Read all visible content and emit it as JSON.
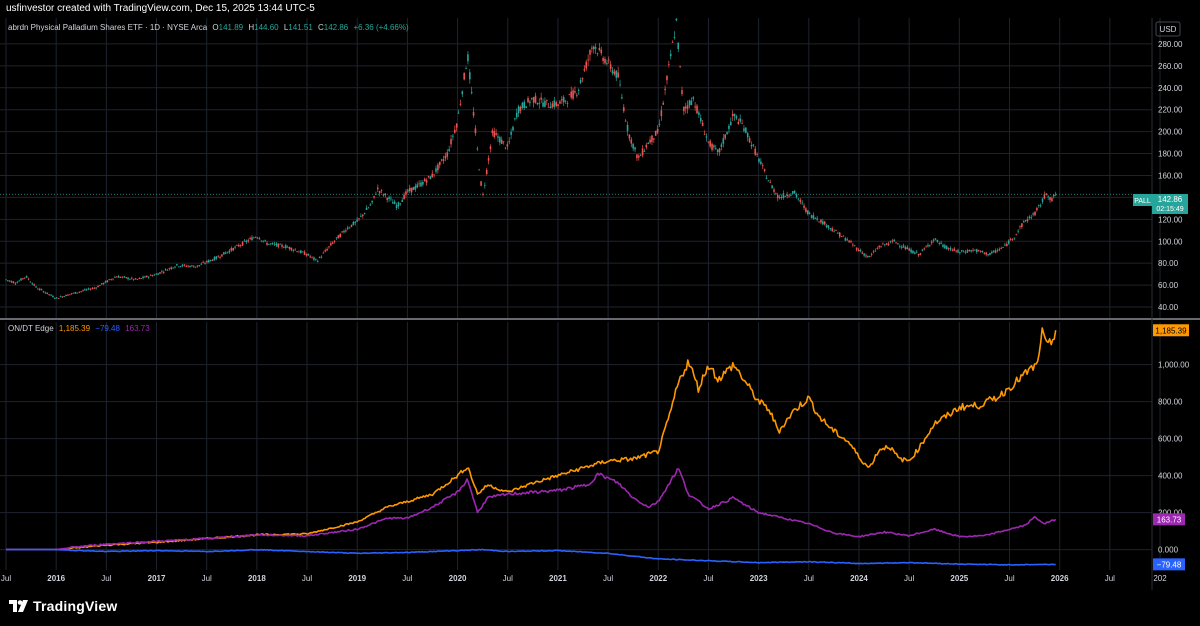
{
  "header": {
    "attribution": "usfinvestor created with TradingView.com, Dec 15, 2025 13:44 UTC-5"
  },
  "footer": {
    "brand": "TradingView"
  },
  "colors": {
    "background": "#000000",
    "grid": "#1f232e",
    "up": "#26a69a",
    "down": "#ef5350",
    "orange": "#ff9800",
    "purple": "#9c27b0",
    "blue": "#2962ff",
    "axis_text": "#d1d4dc",
    "pall_badge": "#26a69a"
  },
  "top_pane": {
    "legend": {
      "title": "abrdn Physical Palladium Shares ETF · 1D · NYSE Arca",
      "o_label": "O",
      "o": "141.89",
      "h_label": "H",
      "h": "144.60",
      "l_label": "L",
      "l": "141.51",
      "c_label": "C",
      "c": "142.86",
      "change": "+6.36 (+4.66%)"
    },
    "currency": "USD",
    "price_badge": {
      "symbol": "PALL",
      "price": "142.86",
      "countdown": "02:15:49"
    }
  },
  "bottom_pane": {
    "legend": {
      "title": "ON/DT Edge",
      "v1": "1,185.39",
      "v2": "−79.48",
      "v3": "163.73"
    },
    "badges": {
      "orange": "1,185.39",
      "purple": "163.73",
      "blue": "−79.48"
    }
  },
  "chart_data": [
    {
      "type": "candlestick",
      "title": "abrdn Physical Palladium Shares ETF · 1D · NYSE Arca",
      "ylabel": "USD",
      "ylim": [
        30,
        300
      ],
      "yticks": [
        40,
        60,
        80,
        100,
        120,
        140,
        160,
        180,
        200,
        220,
        240,
        260,
        280
      ],
      "ytick_labels": [
        "40.00",
        "60.00",
        "80.00",
        "100.00",
        "120.00",
        "140.00",
        "160.00",
        "180.00",
        "200.00",
        "220.00",
        "240.00",
        "260.00",
        "280.00"
      ],
      "grid": true,
      "x_start": 2015.5,
      "x_end": 2026.9,
      "price_path": [
        [
          2015.5,
          65
        ],
        [
          2015.6,
          62
        ],
        [
          2015.7,
          68
        ],
        [
          2015.8,
          58
        ],
        [
          2016.0,
          48
        ],
        [
          2016.15,
          52
        ],
        [
          2016.4,
          58
        ],
        [
          2016.6,
          68
        ],
        [
          2016.8,
          65
        ],
        [
          2017.0,
          70
        ],
        [
          2017.2,
          78
        ],
        [
          2017.4,
          77
        ],
        [
          2017.6,
          85
        ],
        [
          2017.8,
          95
        ],
        [
          2018.0,
          105
        ],
        [
          2018.1,
          98
        ],
        [
          2018.3,
          95
        ],
        [
          2018.5,
          88
        ],
        [
          2018.6,
          82
        ],
        [
          2018.75,
          98
        ],
        [
          2018.9,
          112
        ],
        [
          2019.0,
          118
        ],
        [
          2019.15,
          135
        ],
        [
          2019.2,
          148
        ],
        [
          2019.3,
          140
        ],
        [
          2019.4,
          132
        ],
        [
          2019.5,
          145
        ],
        [
          2019.6,
          150
        ],
        [
          2019.75,
          160
        ],
        [
          2019.9,
          180
        ],
        [
          2020.0,
          210
        ],
        [
          2020.1,
          270
        ],
        [
          2020.2,
          180
        ],
        [
          2020.25,
          140
        ],
        [
          2020.35,
          200
        ],
        [
          2020.5,
          185
        ],
        [
          2020.6,
          220
        ],
        [
          2020.75,
          230
        ],
        [
          2020.9,
          225
        ],
        [
          2021.0,
          225
        ],
        [
          2021.1,
          230
        ],
        [
          2021.2,
          238
        ],
        [
          2021.35,
          280
        ],
        [
          2021.45,
          268
        ],
        [
          2021.6,
          250
        ],
        [
          2021.7,
          200
        ],
        [
          2021.8,
          175
        ],
        [
          2021.9,
          190
        ],
        [
          2022.0,
          200
        ],
        [
          2022.1,
          255
        ],
        [
          2022.18,
          300
        ],
        [
          2022.25,
          220
        ],
        [
          2022.35,
          230
        ],
        [
          2022.5,
          190
        ],
        [
          2022.6,
          180
        ],
        [
          2022.75,
          215
        ],
        [
          2022.85,
          205
        ],
        [
          2023.0,
          175
        ],
        [
          2023.1,
          155
        ],
        [
          2023.2,
          140
        ],
        [
          2023.35,
          145
        ],
        [
          2023.5,
          125
        ],
        [
          2023.6,
          120
        ],
        [
          2023.75,
          110
        ],
        [
          2023.9,
          100
        ],
        [
          2024.0,
          92
        ],
        [
          2024.1,
          85
        ],
        [
          2024.2,
          95
        ],
        [
          2024.35,
          100
        ],
        [
          2024.5,
          92
        ],
        [
          2024.6,
          88
        ],
        [
          2024.75,
          102
        ],
        [
          2024.85,
          95
        ],
        [
          2025.0,
          90
        ],
        [
          2025.15,
          92
        ],
        [
          2025.3,
          88
        ],
        [
          2025.45,
          95
        ],
        [
          2025.55,
          105
        ],
        [
          2025.65,
          118
        ],
        [
          2025.75,
          125
        ],
        [
          2025.82,
          135
        ],
        [
          2025.87,
          145
        ],
        [
          2025.92,
          137
        ],
        [
          2025.96,
          142.86
        ]
      ],
      "last_price": 142.86,
      "series": [
        {
          "name": "PALL"
        }
      ]
    },
    {
      "type": "line",
      "title": "ON/DT Edge",
      "ylim": [
        -110,
        1230
      ],
      "yticks": [
        0,
        200,
        400,
        600,
        800,
        1000
      ],
      "ytick_labels": [
        "0.000",
        "200.00",
        "400.00",
        "600.00",
        "800.00",
        "1,000.00"
      ],
      "grid": true,
      "x_axis_ticks": [
        {
          "x": 2015.5,
          "label": "Jul"
        },
        {
          "x": 2016.0,
          "label": "2016"
        },
        {
          "x": 2016.5,
          "label": "Jul"
        },
        {
          "x": 2017.0,
          "label": "2017"
        },
        {
          "x": 2017.5,
          "label": "Jul"
        },
        {
          "x": 2018.0,
          "label": "2018"
        },
        {
          "x": 2018.5,
          "label": "Jul"
        },
        {
          "x": 2019.0,
          "label": "2019"
        },
        {
          "x": 2019.5,
          "label": "Jul"
        },
        {
          "x": 2020.0,
          "label": "2020"
        },
        {
          "x": 2020.5,
          "label": "Jul"
        },
        {
          "x": 2021.0,
          "label": "2021"
        },
        {
          "x": 2021.5,
          "label": "Jul"
        },
        {
          "x": 2022.0,
          "label": "2022"
        },
        {
          "x": 2022.5,
          "label": "Jul"
        },
        {
          "x": 2023.0,
          "label": "2023"
        },
        {
          "x": 2023.5,
          "label": "Jul"
        },
        {
          "x": 2024.0,
          "label": "2024"
        },
        {
          "x": 2024.5,
          "label": "Jul"
        },
        {
          "x": 2025.0,
          "label": "2025"
        },
        {
          "x": 2025.5,
          "label": "Jul"
        },
        {
          "x": 2026.0,
          "label": "2026"
        },
        {
          "x": 2026.5,
          "label": "Jul"
        },
        {
          "x": 2027.0,
          "label": "202"
        }
      ],
      "series": [
        {
          "color_key": "orange",
          "points": [
            [
              2015.5,
              0
            ],
            [
              2016.0,
              0
            ],
            [
              2016.2,
              10
            ],
            [
              2016.5,
              25
            ],
            [
              2017.0,
              40
            ],
            [
              2017.5,
              60
            ],
            [
              2018.0,
              80
            ],
            [
              2018.5,
              85
            ],
            [
              2019.0,
              150
            ],
            [
              2019.3,
              230
            ],
            [
              2019.5,
              260
            ],
            [
              2019.75,
              300
            ],
            [
              2020.0,
              400
            ],
            [
              2020.1,
              450
            ],
            [
              2020.2,
              300
            ],
            [
              2020.3,
              350
            ],
            [
              2020.5,
              310
            ],
            [
              2020.75,
              360
            ],
            [
              2021.0,
              400
            ],
            [
              2021.3,
              450
            ],
            [
              2021.5,
              480
            ],
            [
              2021.75,
              490
            ],
            [
              2022.0,
              530
            ],
            [
              2022.1,
              700
            ],
            [
              2022.2,
              900
            ],
            [
              2022.3,
              1020
            ],
            [
              2022.4,
              870
            ],
            [
              2022.5,
              1000
            ],
            [
              2022.6,
              920
            ],
            [
              2022.75,
              1000
            ],
            [
              2022.85,
              920
            ],
            [
              2023.0,
              800
            ],
            [
              2023.1,
              760
            ],
            [
              2023.2,
              640
            ],
            [
              2023.35,
              750
            ],
            [
              2023.5,
              820
            ],
            [
              2023.6,
              720
            ],
            [
              2023.75,
              640
            ],
            [
              2023.9,
              580
            ],
            [
              2024.0,
              500
            ],
            [
              2024.1,
              440
            ],
            [
              2024.2,
              540
            ],
            [
              2024.3,
              560
            ],
            [
              2024.4,
              490
            ],
            [
              2024.5,
              480
            ],
            [
              2024.6,
              550
            ],
            [
              2024.75,
              680
            ],
            [
              2024.9,
              730
            ],
            [
              2025.0,
              770
            ],
            [
              2025.2,
              780
            ],
            [
              2025.4,
              830
            ],
            [
              2025.55,
              900
            ],
            [
              2025.7,
              970
            ],
            [
              2025.78,
              1000
            ],
            [
              2025.82,
              1180
            ],
            [
              2025.87,
              1100
            ],
            [
              2025.92,
              1120
            ],
            [
              2025.96,
              1185.39
            ]
          ]
        },
        {
          "color_key": "purple",
          "points": [
            [
              2015.5,
              0
            ],
            [
              2016.0,
              0
            ],
            [
              2016.2,
              15
            ],
            [
              2016.5,
              30
            ],
            [
              2017.0,
              45
            ],
            [
              2017.5,
              60
            ],
            [
              2018.0,
              80
            ],
            [
              2018.5,
              75
            ],
            [
              2019.0,
              110
            ],
            [
              2019.3,
              170
            ],
            [
              2019.5,
              170
            ],
            [
              2019.75,
              230
            ],
            [
              2020.0,
              310
            ],
            [
              2020.1,
              380
            ],
            [
              2020.2,
              200
            ],
            [
              2020.3,
              280
            ],
            [
              2020.5,
              300
            ],
            [
              2020.75,
              310
            ],
            [
              2021.0,
              320
            ],
            [
              2021.3,
              350
            ],
            [
              2021.4,
              410
            ],
            [
              2021.6,
              360
            ],
            [
              2021.75,
              280
            ],
            [
              2021.9,
              230
            ],
            [
              2022.0,
              260
            ],
            [
              2022.1,
              350
            ],
            [
              2022.2,
              440
            ],
            [
              2022.3,
              300
            ],
            [
              2022.5,
              220
            ],
            [
              2022.75,
              280
            ],
            [
              2022.9,
              230
            ],
            [
              2023.0,
              200
            ],
            [
              2023.25,
              170
            ],
            [
              2023.5,
              140
            ],
            [
              2023.75,
              90
            ],
            [
              2024.0,
              70
            ],
            [
              2024.25,
              95
            ],
            [
              2024.5,
              75
            ],
            [
              2024.75,
              110
            ],
            [
              2025.0,
              70
            ],
            [
              2025.25,
              75
            ],
            [
              2025.5,
              110
            ],
            [
              2025.65,
              130
            ],
            [
              2025.75,
              175
            ],
            [
              2025.85,
              140
            ],
            [
              2025.96,
              163.73
            ]
          ]
        },
        {
          "color_key": "blue",
          "points": [
            [
              2015.5,
              0
            ],
            [
              2016.0,
              0
            ],
            [
              2016.5,
              -10
            ],
            [
              2017.0,
              -5
            ],
            [
              2017.5,
              -10
            ],
            [
              2018.0,
              0
            ],
            [
              2018.5,
              -10
            ],
            [
              2019.0,
              -20
            ],
            [
              2019.5,
              -15
            ],
            [
              2020.0,
              -5
            ],
            [
              2020.25,
              0
            ],
            [
              2020.5,
              -10
            ],
            [
              2021.0,
              -5
            ],
            [
              2021.5,
              -20
            ],
            [
              2022.0,
              -50
            ],
            [
              2022.5,
              -60
            ],
            [
              2023.0,
              -70
            ],
            [
              2023.5,
              -65
            ],
            [
              2024.0,
              -75
            ],
            [
              2024.5,
              -70
            ],
            [
              2025.0,
              -78
            ],
            [
              2025.5,
              -82
            ],
            [
              2025.96,
              -79.48
            ]
          ]
        }
      ],
      "last_values": {
        "orange": 1185.39,
        "purple": 163.73,
        "blue": -79.48
      }
    }
  ]
}
